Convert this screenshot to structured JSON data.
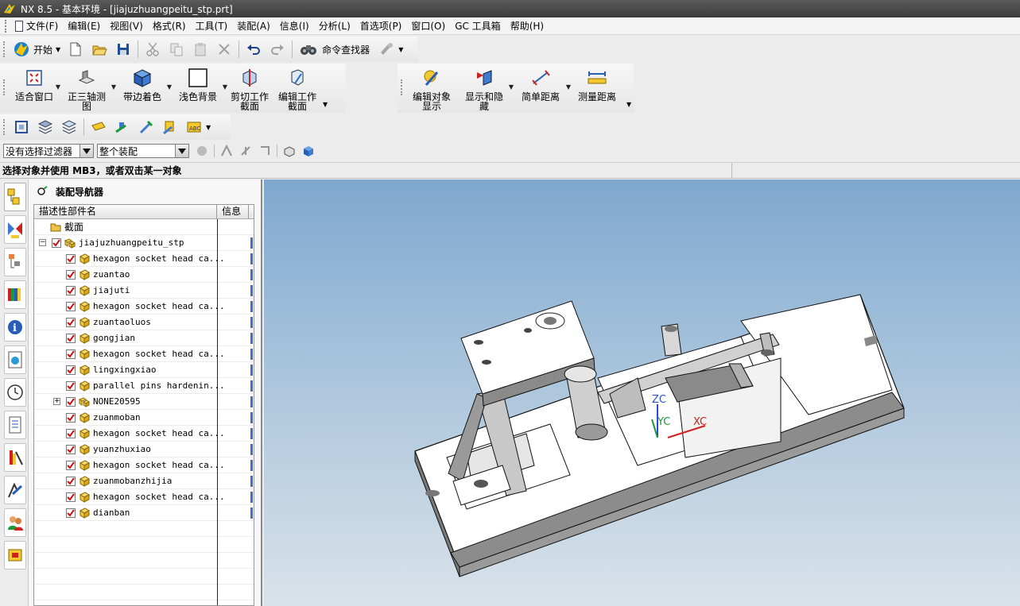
{
  "window": {
    "title": "NX 8.5 - 基本环境 - [jiajuzhuangpeitu_stp.prt]"
  },
  "menu": {
    "items": [
      "文件(F)",
      "编辑(E)",
      "视图(V)",
      "格式(R)",
      "工具(T)",
      "装配(A)",
      "信息(I)",
      "分析(L)",
      "首选项(P)",
      "窗口(O)",
      "GC 工具箱",
      "帮助(H)"
    ]
  },
  "toolbar_standard": {
    "start_label": "开始",
    "command_finder_label": "命令查找器"
  },
  "toolbar_view": {
    "fit_window": "适合窗口",
    "trimetric_1": "正三轴测",
    "trimetric_2": "图",
    "shaded_edges": "带边着色",
    "light_bg": "浅色背景",
    "clip_section_1": "剪切工作",
    "clip_section_2": "截面",
    "edit_section_1": "编辑工作",
    "edit_section_2": "截面"
  },
  "toolbar_util": {
    "edit_display_1": "编辑对象",
    "edit_display_2": "显示",
    "show_hide_1": "显示和隐",
    "show_hide_2": "藏",
    "simple_distance": "简单距离",
    "measure_distance": "测量距离"
  },
  "selection": {
    "filter_value": "没有选择过滤器",
    "scope_value": "整个装配"
  },
  "status": {
    "prompt": "选择对象并使用 MB3，或者双击某一对象"
  },
  "navigator": {
    "title": "装配导航器",
    "col_name": "描述性部件名",
    "col_info": "信息",
    "section_node": "截面",
    "root": "jiajuzhuangpeitu_stp",
    "parts": [
      "hexagon socket head ca...",
      "zuantao",
      "jiajuti",
      "hexagon socket head ca...",
      "zuantaoluos",
      "gongjian",
      "hexagon socket head ca...",
      "lingxingxiao",
      "parallel pins hardenin...",
      "NONE20595",
      "zuanmoban",
      "hexagon socket head ca...",
      "yuanzhuxiao",
      "hexagon socket head ca...",
      "zuanmobanzhijia",
      "hexagon socket head ca...",
      "dianban"
    ]
  },
  "viewport": {
    "axis_z": "ZC",
    "axis_y": "YC",
    "axis_x": "XC"
  }
}
